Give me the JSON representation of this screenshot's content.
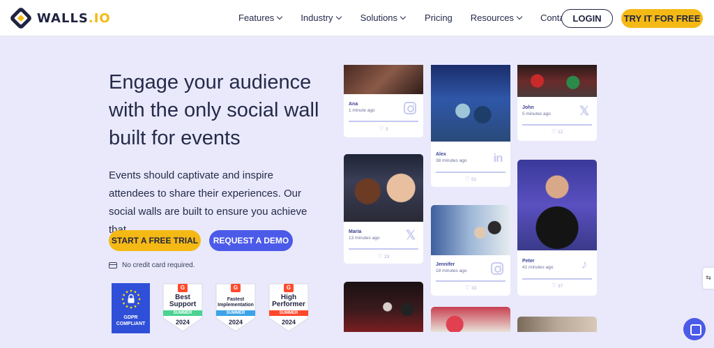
{
  "nav": {
    "brand": "WALLS",
    "brand_suffix": ".IO",
    "menu": [
      {
        "label": "Features",
        "dropdown": true
      },
      {
        "label": "Industry",
        "dropdown": true
      },
      {
        "label": "Solutions",
        "dropdown": true
      },
      {
        "label": "Pricing",
        "dropdown": false
      },
      {
        "label": "Resources",
        "dropdown": true
      },
      {
        "label": "Contact",
        "dropdown": false
      }
    ],
    "login": "LOGIN",
    "try": "TRY IT FOR FREE"
  },
  "hero": {
    "title": "Engage your audience with the only social wall built for events",
    "description": "Events should captivate and inspire attendees to share their experiences. Our social walls are built to ensure you achieve that.",
    "cta_trial": "START A FREE TRIAL",
    "cta_demo": "REQUEST A DEMO",
    "no_card": "No credit card required."
  },
  "badges": {
    "gdpr": {
      "line1": "GDPR",
      "line2": "COMPLIANT"
    },
    "g2": [
      {
        "name": "Best Support",
        "season": "SUMMER",
        "year": "2024",
        "color": "#4ad391"
      },
      {
        "name": "Fastest Implementation",
        "season": "SUMMER",
        "year": "2024",
        "color": "#3ba3e8"
      },
      {
        "name": "High Performer",
        "season": "SUMMER",
        "year": "2024",
        "color": "#ff492c"
      }
    ]
  },
  "posts": [
    {
      "name": "Ana",
      "time": "1 minute ago",
      "network": "instagram-icon",
      "likes": "3"
    },
    {
      "name": "Alex",
      "time": "38 minutes ago",
      "network": "linkedin-icon",
      "likes": "51"
    },
    {
      "name": "John",
      "time": "5 minutes ago",
      "network": "x-icon",
      "likes": "12"
    },
    {
      "name": "Maria",
      "time": "13 minutes ago",
      "network": "x-icon",
      "likes": "23"
    },
    {
      "name": "Jennifer",
      "time": "18 minutes ago",
      "network": "instagram-icon",
      "likes": "33"
    },
    {
      "name": "Peter",
      "time": "41 minutes ago",
      "network": "tiktok-icon",
      "likes": "37"
    }
  ],
  "colors": {
    "background": "#e9e9fb",
    "accent_yellow": "#f5b915",
    "accent_blue": "#4b5ae8",
    "text_dark": "#252a4a"
  }
}
